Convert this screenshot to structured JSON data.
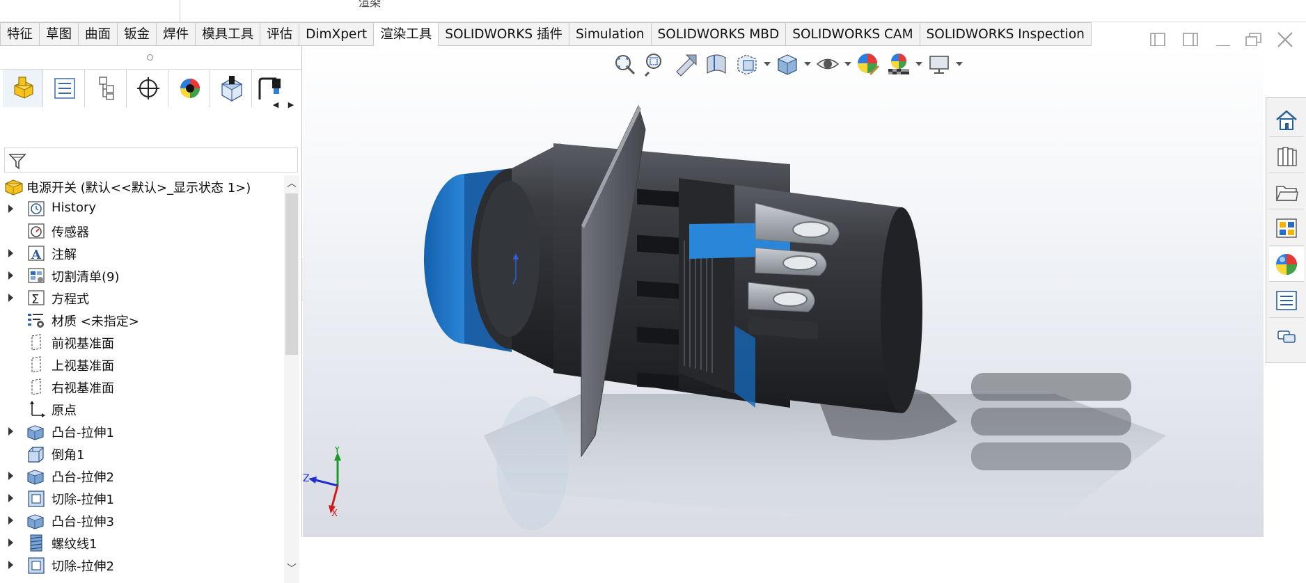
{
  "window": {
    "top_title": "渲染"
  },
  "tabs": [
    {
      "label": "特征"
    },
    {
      "label": "草图"
    },
    {
      "label": "曲面"
    },
    {
      "label": "钣金"
    },
    {
      "label": "焊件"
    },
    {
      "label": "模具工具"
    },
    {
      "label": "评估"
    },
    {
      "label": "DimXpert"
    },
    {
      "label": "渲染工具",
      "active": true
    },
    {
      "label": "SOLIDWORKS 插件"
    },
    {
      "label": "Simulation"
    },
    {
      "label": "SOLIDWORKS MBD"
    },
    {
      "label": "SOLIDWORKS CAM"
    },
    {
      "label": "SOLIDWORKS Inspection"
    }
  ],
  "window_controls": [
    "restore-left-icon",
    "restore-right-icon",
    "minimize-icon",
    "maximize-icon",
    "close-icon"
  ],
  "manager_tabs": [
    "featuremanager-icon",
    "propertymanager-icon",
    "configurationmanager-icon",
    "dimxpertmanager-icon",
    "displaymanager-icon",
    "cam-feature-tree-icon",
    "cam-operation-tree-icon"
  ],
  "tree": {
    "root": "电源开关 (默认<<默认>_显示状态 1>)",
    "items": [
      {
        "label": "History",
        "expandable": true,
        "icon": "history-icon"
      },
      {
        "label": "传感器",
        "expandable": false,
        "icon": "sensor-icon"
      },
      {
        "label": "注解",
        "expandable": true,
        "icon": "annotation-icon"
      },
      {
        "label": "切割清单(9)",
        "expandable": true,
        "icon": "cutlist-icon"
      },
      {
        "label": "方程式",
        "expandable": true,
        "icon": "equation-icon"
      },
      {
        "label": "材质 <未指定>",
        "expandable": false,
        "icon": "material-icon"
      },
      {
        "label": "前视基准面",
        "expandable": false,
        "icon": "plane-icon"
      },
      {
        "label": "上视基准面",
        "expandable": false,
        "icon": "plane-icon"
      },
      {
        "label": "右视基准面",
        "expandable": false,
        "icon": "plane-icon"
      },
      {
        "label": "原点",
        "expandable": false,
        "icon": "origin-icon"
      },
      {
        "label": "凸台-拉伸1",
        "expandable": true,
        "icon": "boss-extrude-icon"
      },
      {
        "label": "倒角1",
        "expandable": false,
        "icon": "chamfer-icon"
      },
      {
        "label": "凸台-拉伸2",
        "expandable": true,
        "icon": "boss-extrude-icon"
      },
      {
        "label": "切除-拉伸1",
        "expandable": true,
        "icon": "cut-extrude-icon"
      },
      {
        "label": "凸台-拉伸3",
        "expandable": true,
        "icon": "boss-extrude-icon"
      },
      {
        "label": "螺纹线1",
        "expandable": true,
        "icon": "thread-icon"
      },
      {
        "label": "切除-拉伸2",
        "expandable": true,
        "icon": "cut-extrude-icon"
      }
    ]
  },
  "hud": [
    "zoom-to-fit-icon",
    "zoom-to-area-icon",
    "previous-view-icon",
    "section-view-icon",
    "view-orientation-icon",
    "display-style-icon",
    "hide-show-items-icon",
    "edit-appearance-icon",
    "apply-scene-icon",
    "view-settings-icon"
  ],
  "triad": {
    "x": "X",
    "y": "Y",
    "z": "Z"
  },
  "task_pane": [
    "home-icon",
    "design-library-icon",
    "file-explorer-icon",
    "view-palette-icon",
    "appearances-icon",
    "custom-properties-icon",
    "forum-icon"
  ],
  "colors": {
    "accent_blue": "#1f73c4",
    "body_dark": "#2b2d31",
    "metal": "#9aa0a6"
  }
}
